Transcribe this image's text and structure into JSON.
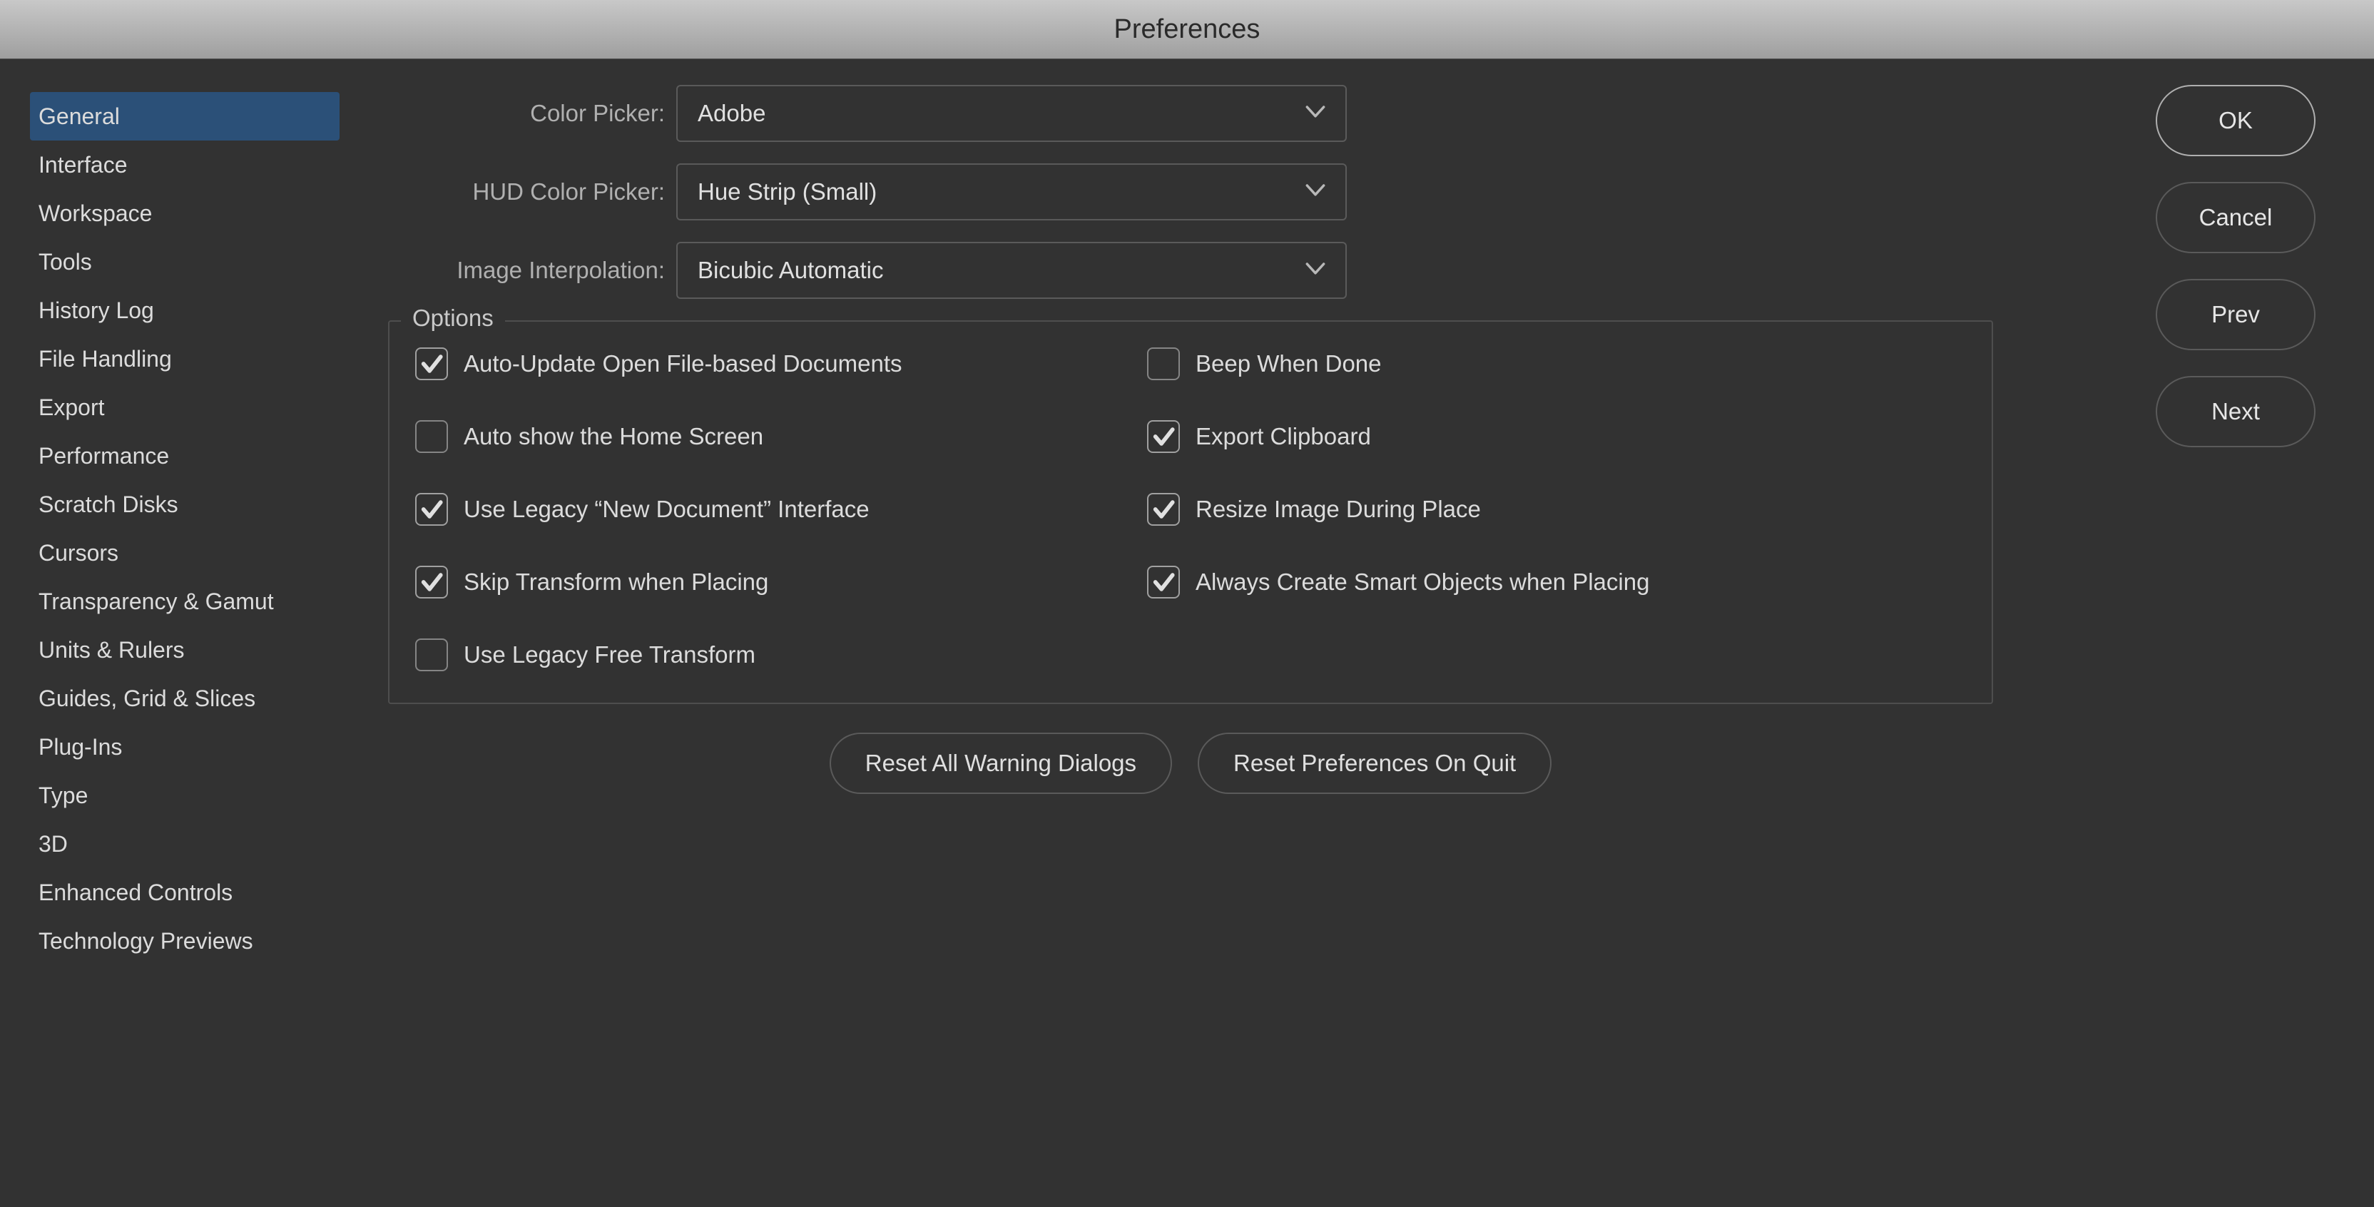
{
  "window_title": "Preferences",
  "sidebar": {
    "items": [
      "General",
      "Interface",
      "Workspace",
      "Tools",
      "History Log",
      "File Handling",
      "Export",
      "Performance",
      "Scratch Disks",
      "Cursors",
      "Transparency & Gamut",
      "Units & Rulers",
      "Guides, Grid & Slices",
      "Plug-Ins",
      "Type",
      "3D",
      "Enhanced Controls",
      "Technology Previews"
    ],
    "selected_index": 0
  },
  "form": {
    "rows": [
      {
        "label": "Color Picker:",
        "value": "Adobe",
        "name": "color-picker-select"
      },
      {
        "label": "HUD Color Picker:",
        "value": "Hue Strip (Small)",
        "name": "hud-color-picker-select"
      },
      {
        "label": "Image Interpolation:",
        "value": "Bicubic Automatic",
        "name": "image-interpolation-select"
      }
    ]
  },
  "options": {
    "legend": "Options",
    "left": [
      {
        "label": "Auto-Update Open File-based Documents",
        "checked": true,
        "name": "auto-update-documents-checkbox"
      },
      {
        "label": "Auto show the Home Screen",
        "checked": false,
        "name": "auto-show-home-screen-checkbox"
      },
      {
        "label": "Use Legacy “New Document” Interface",
        "checked": true,
        "name": "legacy-new-document-checkbox"
      },
      {
        "label": "Skip Transform when Placing",
        "checked": true,
        "name": "skip-transform-placing-checkbox"
      },
      {
        "label": "Use Legacy Free Transform",
        "checked": false,
        "name": "legacy-free-transform-checkbox"
      }
    ],
    "right": [
      {
        "label": "Beep When Done",
        "checked": false,
        "name": "beep-when-done-checkbox"
      },
      {
        "label": "Export Clipboard",
        "checked": true,
        "name": "export-clipboard-checkbox"
      },
      {
        "label": "Resize Image During Place",
        "checked": true,
        "name": "resize-image-during-place-checkbox"
      },
      {
        "label": "Always Create Smart Objects when Placing",
        "checked": true,
        "name": "always-create-smart-objects-checkbox"
      }
    ]
  },
  "reset_buttons": {
    "all_warnings": "Reset All Warning Dialogs",
    "on_quit": "Reset Preferences On Quit"
  },
  "side_buttons": {
    "ok": "OK",
    "cancel": "Cancel",
    "prev": "Prev",
    "next": "Next"
  }
}
